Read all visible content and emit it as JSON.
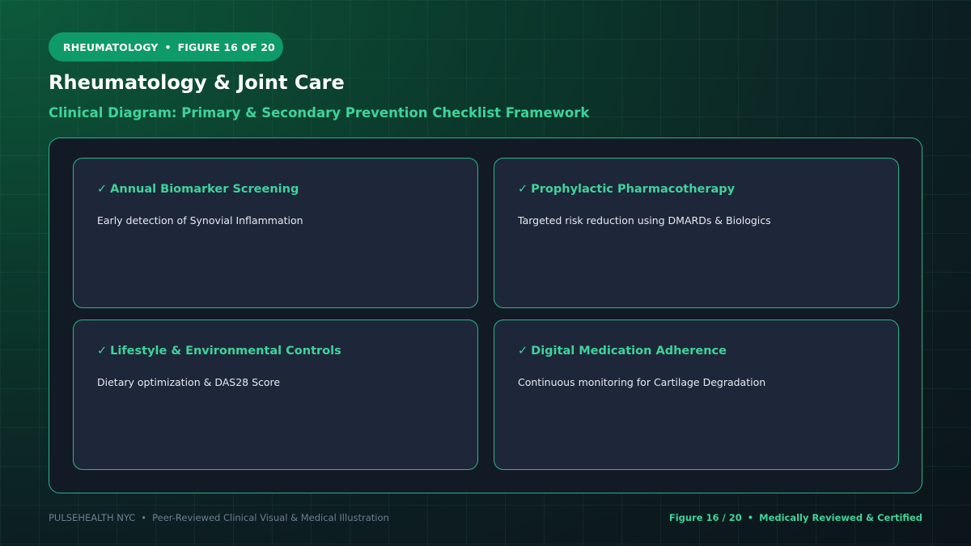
{
  "badge": {
    "category": "RHEUMATOLOGY",
    "separator": "•",
    "figure": "FIGURE 16 OF 20"
  },
  "title": "Rheumatology & Joint Care",
  "subtitle": "Clinical Diagram: Primary & Secondary Prevention Checklist Framework",
  "check_glyph": "✓",
  "checklist": [
    {
      "heading": "Annual Biomarker Screening",
      "description": "Early detection of Synovial Inflammation"
    },
    {
      "heading": "Prophylactic Pharmacotherapy",
      "description": "Targeted risk reduction using DMARDs & Biologics"
    },
    {
      "heading": "Lifestyle & Environmental Controls",
      "description": "Dietary optimization & DAS28 Score"
    },
    {
      "heading": "Digital Medication Adherence",
      "description": "Continuous monitoring for Cartilage Degradation"
    }
  ],
  "footer": {
    "brand": "PULSEHEALTH NYC",
    "separator": "•",
    "tagline": "Peer-Reviewed Clinical Visual & Medical Illustration",
    "figure": "Figure 16 / 20",
    "certification": "Medically Reviewed & Certified"
  },
  "colors": {
    "accent": "#3ed39a",
    "badge": "#0f9a6a",
    "border": "#2bb585",
    "card": "#1e2739",
    "panel": "#121a26"
  }
}
